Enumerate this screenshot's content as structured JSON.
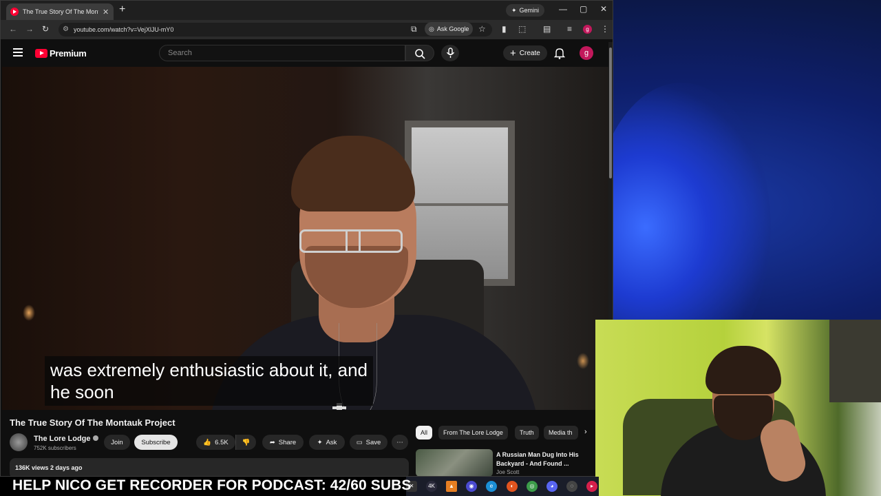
{
  "browser": {
    "tab_title": "The True Story Of The Montauk Project",
    "url": "youtube.com/watch?v=VejXlJU-mY0",
    "gemini_label": "Gemini",
    "ask_google_label": "Ask Google",
    "profile_initial": "g"
  },
  "yt": {
    "logo_text": "Premium",
    "search_placeholder": "Search",
    "create_label": "Create",
    "avatar_initial": "g"
  },
  "video": {
    "caption_line1": "was extremely enthusiastic about it, and",
    "caption_line2": "he soon",
    "title": "The True Story Of The Montauk Project"
  },
  "channel": {
    "name": "The Lore Lodge",
    "subscribers": "752K subscribers",
    "join_label": "Join",
    "subscribe_label": "Subscribe"
  },
  "actions": {
    "likes": "6.5K",
    "share_label": "Share",
    "ask_label": "Ask",
    "save_label": "Save"
  },
  "description": {
    "meta": "136K views  2 days ago"
  },
  "chips": [
    "All",
    "From The Lore Lodge",
    "Truth",
    "Media th"
  ],
  "recommendation": {
    "title": "A Russian Man Dug Into His Backyard - And Found ...",
    "channel": "Joe Scott"
  },
  "banner": {
    "text": "HELP NICO GET RECORDER FOR PODCAST: 42/60 SUBS"
  },
  "taskbar": {
    "items": [
      "4K"
    ]
  },
  "colors": {
    "yt_red": "#ff0033",
    "bg_dark": "#0f0f0f",
    "pill_bg": "#272727"
  }
}
